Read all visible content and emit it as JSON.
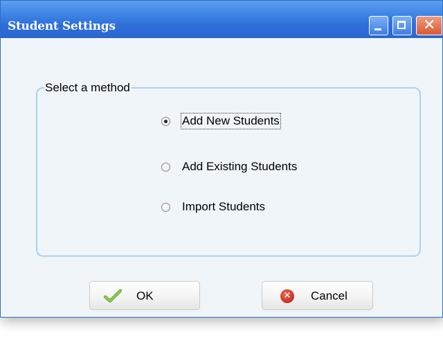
{
  "window": {
    "title": "Student Settings",
    "controls": {
      "minimize_icon": "minimize-icon",
      "maximize_icon": "maximize-icon",
      "close_icon": "close-icon",
      "close_glyph": "✕"
    },
    "colors": {
      "titlebar": "#2e6fd9",
      "close_button": "#d95a34",
      "groupbox_border": "#a9d2f0",
      "body_background": "#f0f5f9"
    }
  },
  "method_group": {
    "legend": "Select a method",
    "options": [
      {
        "label": "Add New Students",
        "selected": true
      },
      {
        "label": "Add Existing Students",
        "selected": false
      },
      {
        "label": "Import Students",
        "selected": false
      }
    ]
  },
  "buttons": {
    "ok": {
      "label": "OK",
      "icon": "checkmark-icon"
    },
    "cancel": {
      "label": "Cancel",
      "icon": "cancel-x-icon",
      "glyph": "✕"
    }
  }
}
